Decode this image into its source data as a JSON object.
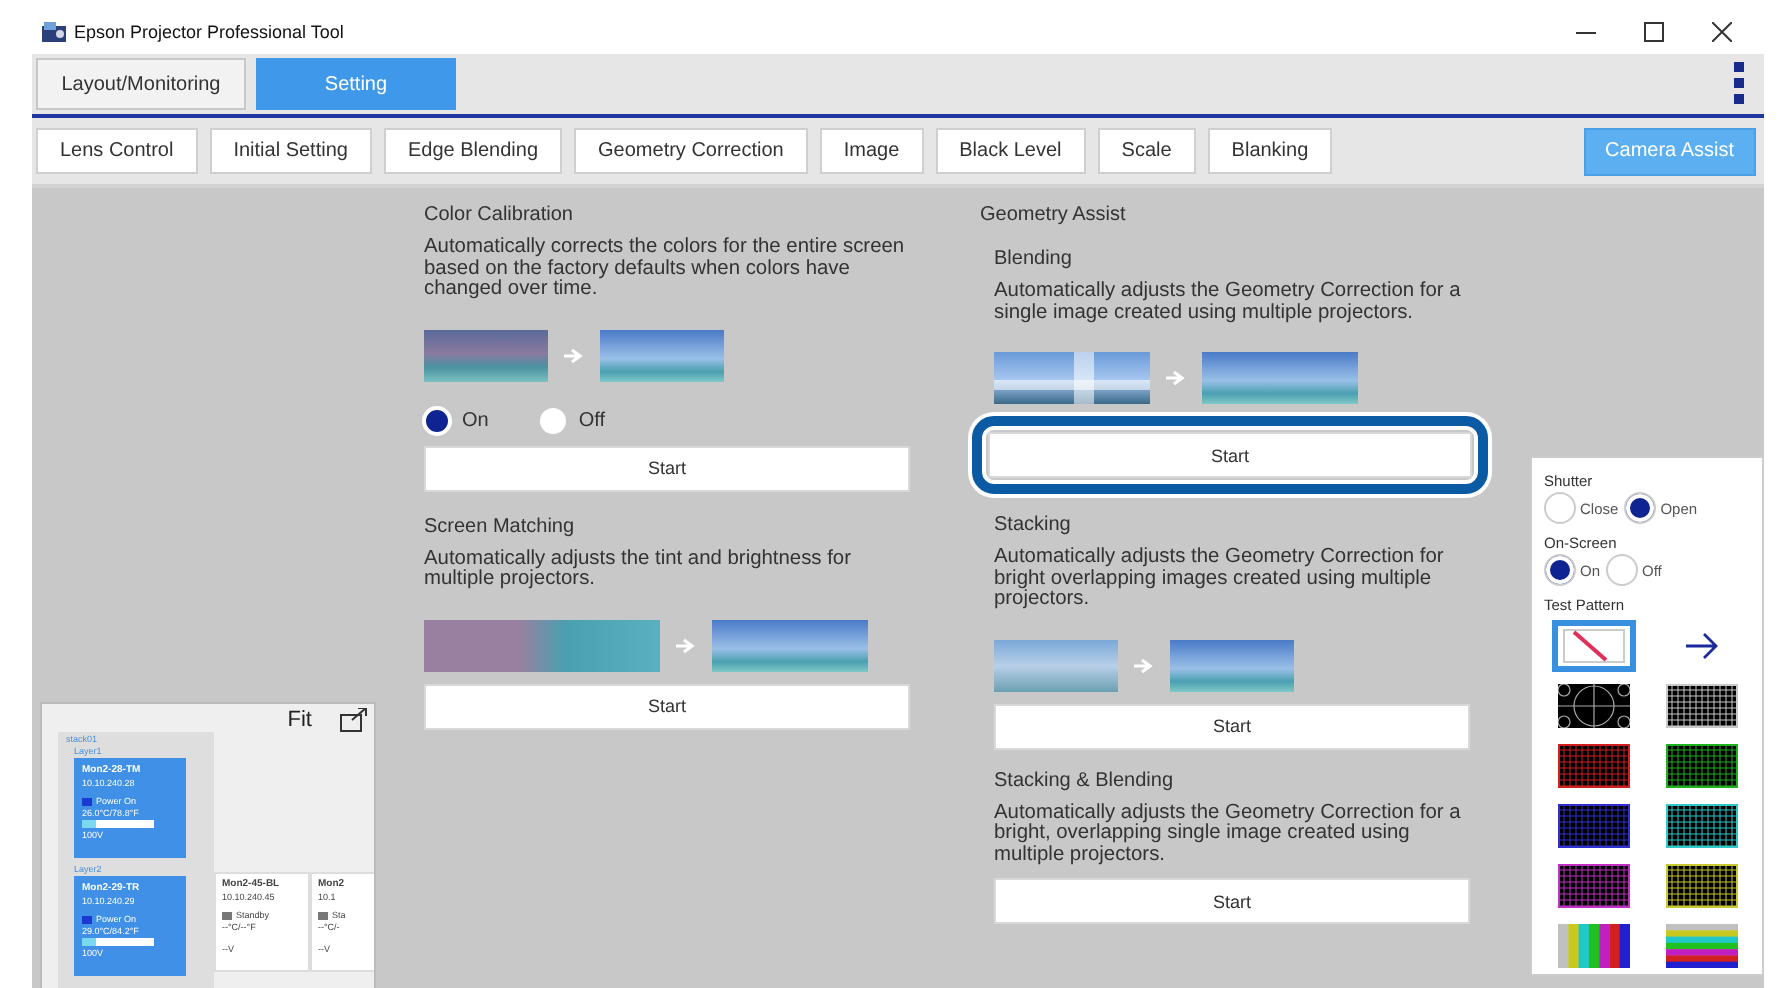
{
  "window": {
    "title": "Epson Projector Professional Tool"
  },
  "main_tabs": [
    {
      "label": "Layout/Monitoring",
      "selected": false
    },
    {
      "label": "Setting",
      "selected": true
    }
  ],
  "sub_tabs": [
    {
      "label": "Lens Control",
      "selected": false
    },
    {
      "label": "Initial Setting",
      "selected": false
    },
    {
      "label": "Edge Blending",
      "selected": false
    },
    {
      "label": "Geometry Correction",
      "selected": false
    },
    {
      "label": "Image",
      "selected": false
    },
    {
      "label": "Black Level",
      "selected": false
    },
    {
      "label": "Scale",
      "selected": false
    },
    {
      "label": "Blanking",
      "selected": false
    }
  ],
  "camera_assist": {
    "label": "Camera Assist"
  },
  "left_sections": [
    {
      "title": "Color Calibration",
      "description": "Automatically corrects the colors for the entire screen based on the factory defaults when colors have changed over time.",
      "kind": "tinted",
      "options": [
        {
          "label": "On",
          "selected": true
        },
        {
          "label": "Off",
          "selected": false
        }
      ],
      "button": {
        "label": "Start",
        "highlighted": false
      }
    },
    {
      "title": "Screen Matching",
      "description": "Automatically adjusts the tint and brightness for multiple projectors.",
      "kind": "split",
      "button": {
        "label": "Start",
        "highlighted": false
      }
    }
  ],
  "geometry_assist": {
    "title": "Geometry Assist",
    "sections": [
      {
        "title": "Blending",
        "description": "Automatically adjusts the Geometry Correction for a single image created using multiple projectors.",
        "kind": "cross",
        "button": {
          "label": "Start",
          "highlighted": true
        }
      },
      {
        "title": "Stacking",
        "description": "Automatically adjusts the Geometry Correction for bright overlapping images created using multiple projectors.",
        "kind": "doubled",
        "button": {
          "label": "Start",
          "highlighted": false
        }
      },
      {
        "title": "Stacking & Blending",
        "description": "Automatically adjusts the Geometry Correction for a bright, overlapping single image created using multiple projectors.",
        "kind": "text-only",
        "button": {
          "label": "Start",
          "highlighted": false
        }
      }
    ]
  },
  "minimap": {
    "fit_label": "Fit",
    "group": {
      "name": "stack01",
      "layers": [
        {
          "name": "Layer1",
          "projectors": [
            {
              "name": "Mon2-28-TM",
              "ip": "10.10.240.28",
              "status": "Power On",
              "kind": "active",
              "temperature": "26.0°C/78.8°F",
              "level": 0.2,
              "voltage": "100V"
            }
          ]
        },
        {
          "name": "Layer2",
          "projectors": [
            {
              "name": "Mon2-29-TR",
              "ip": "10.10.240.29",
              "status": "Power On",
              "kind": "active",
              "temperature": "29.0°C/84.2°F",
              "level": 0.2,
              "voltage": "100V"
            }
          ]
        }
      ]
    },
    "loose_projectors": [
      {
        "name": "Mon2-45-BL",
        "ip": "10.10.240.45",
        "status": "Standby",
        "kind": "standby",
        "temperature": "--°C/--°F",
        "voltage": "--V"
      },
      {
        "name": "Mon2",
        "ip": "10.1",
        "status": "Sta",
        "kind": "standby",
        "temperature": "--°C/-",
        "voltage": "--V"
      }
    ]
  },
  "side_panel": {
    "shutter": {
      "label": "Shutter",
      "options": [
        {
          "label": "Close",
          "selected": false
        },
        {
          "label": "Open",
          "selected": true
        }
      ]
    },
    "on_screen": {
      "label": "On-Screen",
      "options": [
        {
          "label": "On",
          "selected": true
        },
        {
          "label": "Off",
          "selected": false
        }
      ]
    },
    "test_pattern": {
      "label": "Test Pattern",
      "patterns": [
        {
          "kind": "blank",
          "selected": true
        },
        {
          "kind": "circles",
          "selected": false
        },
        {
          "kind": "grid",
          "color": "#c8c8c8",
          "selected": false
        },
        {
          "kind": "grid",
          "color": "#d02020",
          "selected": false
        },
        {
          "kind": "grid",
          "color": "#20b020",
          "selected": false
        },
        {
          "kind": "grid",
          "color": "#3030d0",
          "selected": false
        },
        {
          "kind": "grid",
          "color": "#30c8c8",
          "selected": false
        },
        {
          "kind": "grid",
          "color": "#c030c0",
          "selected": false
        },
        {
          "kind": "grid",
          "color": "#c8c830",
          "selected": false
        },
        {
          "kind": "bars-vertical",
          "selected": false
        },
        {
          "kind": "bars-horizontal",
          "selected": false
        }
      ]
    }
  }
}
